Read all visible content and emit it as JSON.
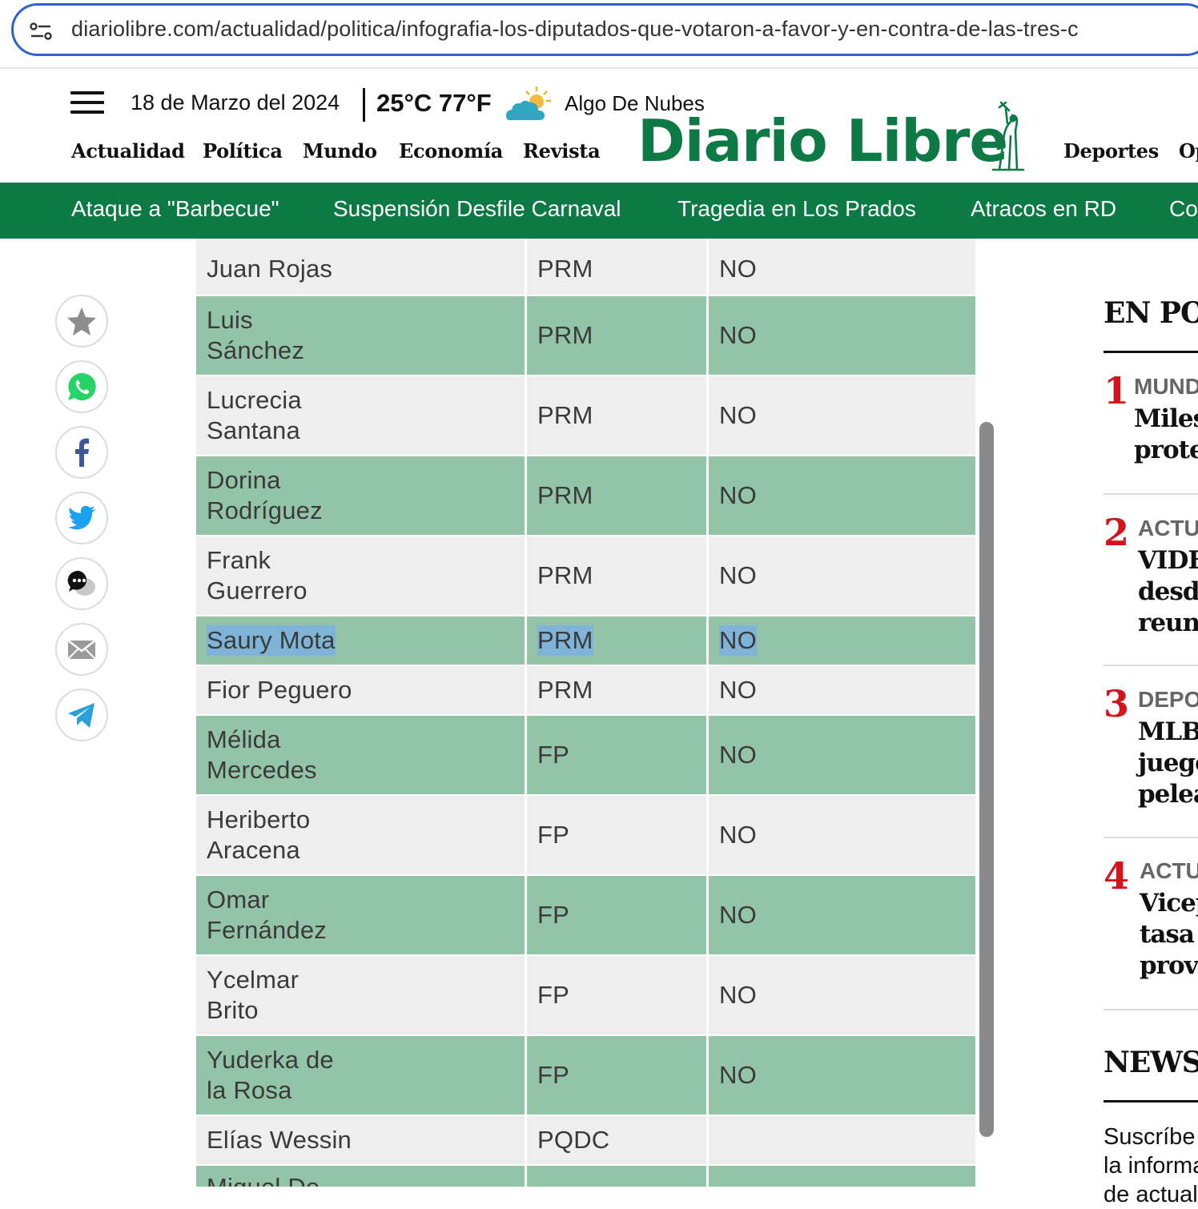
{
  "browser": {
    "url": "diariolibre.com/actualidad/politica/infografia-los-diputados-que-votaron-a-favor-y-en-contra-de-las-tres-c"
  },
  "header": {
    "date": "18 de Marzo del 2024",
    "temperature": "25°C 77°F",
    "condition": "Algo De Nubes",
    "logo": "Diario Libre",
    "nav_left": [
      "Actualidad",
      "Política",
      "Mundo",
      "Economía",
      "Revista"
    ],
    "nav_right": [
      "Deportes",
      "Op"
    ]
  },
  "trending": [
    "Ataque a \"Barbecue\"",
    "Suspensión Desfile Carnaval",
    "Tragedia en Los Prados",
    "Atracos en RD",
    "Co"
  ],
  "share_icons": [
    "star-icon",
    "whatsapp-icon",
    "facebook-icon",
    "twitter-icon",
    "comments-icon",
    "email-icon",
    "telegram-icon"
  ],
  "table": {
    "rows": [
      {
        "name": [
          "Juan Rojas"
        ],
        "party": "PRM",
        "vote": "NO"
      },
      {
        "name": [
          "Luis",
          "Sánchez"
        ],
        "party": "PRM",
        "vote": "NO"
      },
      {
        "name": [
          "Lucrecia",
          "Santana"
        ],
        "party": "PRM",
        "vote": "NO"
      },
      {
        "name": [
          "Dorina",
          "Rodríguez"
        ],
        "party": "PRM",
        "vote": "NO"
      },
      {
        "name": [
          "Frank",
          "Guerrero"
        ],
        "party": "PRM",
        "vote": "NO"
      },
      {
        "name": [
          "Saury Mota"
        ],
        "party": "PRM",
        "vote": "NO",
        "selected": true
      },
      {
        "name": [
          "Fior Peguero"
        ],
        "party": "PRM",
        "vote": "NO"
      },
      {
        "name": [
          "Mélida",
          "Mercedes"
        ],
        "party": "FP",
        "vote": "NO"
      },
      {
        "name": [
          "Heriberto",
          "Aracena"
        ],
        "party": "FP",
        "vote": "NO"
      },
      {
        "name": [
          "Omar",
          "Fernández"
        ],
        "party": "FP",
        "vote": "NO"
      },
      {
        "name": [
          "Ycelmar",
          "Brito"
        ],
        "party": "FP",
        "vote": "NO"
      },
      {
        "name": [
          "Yuderka de",
          "la Rosa"
        ],
        "party": "FP",
        "vote": "NO"
      },
      {
        "name": [
          "Elías Wessin"
        ],
        "party": "PQDC",
        "vote": ""
      },
      {
        "name": [
          "Miguel De"
        ],
        "party": "",
        "vote": ""
      }
    ]
  },
  "sidebar": {
    "popular_title": "EN POI",
    "items": [
      {
        "num": "1",
        "category": "MUND",
        "headline": [
          "Miles",
          "protes"
        ]
      },
      {
        "num": "2",
        "category": "ACTU",
        "headline": [
          "VIDE",
          "desde",
          "reuni"
        ]
      },
      {
        "num": "3",
        "category": "DEPO",
        "headline": [
          "MLB",
          "juego",
          "pelea"
        ]
      },
      {
        "num": "4",
        "category": "ACTU",
        "headline": [
          "Vicep",
          "tasa d",
          "provi"
        ]
      }
    ],
    "newsletter_title": "NEWSI",
    "newsletter_text": [
      "Suscríbe",
      "la informa",
      "de actuali"
    ]
  },
  "colors": {
    "brand_green": "#0d7a45",
    "row_green": "#94c4a8",
    "row_light": "#eeeeee",
    "rank_red": "#d4141b",
    "selection": "#7fb4d8"
  }
}
